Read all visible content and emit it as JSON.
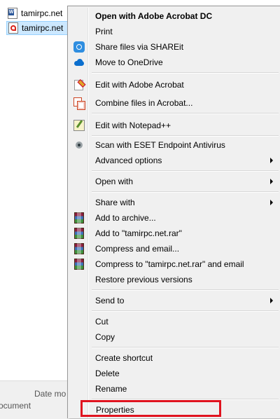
{
  "explorer": {
    "files": [
      {
        "name": "tamirpc.net",
        "icon": "word-doc-icon"
      },
      {
        "name": "tamirpc.net",
        "icon": "pdf-doc-icon"
      }
    ],
    "details": {
      "date_label": "Date mo",
      "type_label": "ocument"
    }
  },
  "menu": {
    "items": [
      {
        "label": "Open with Adobe Acrobat DC",
        "bold": true
      },
      {
        "label": "Print"
      },
      {
        "label": "Share files via SHAREit",
        "icon": "shareit-icon"
      },
      {
        "label": "Move to OneDrive",
        "icon": "onedrive-icon"
      },
      {
        "label": "Edit with Adobe Acrobat",
        "icon": "acrobat-edit-icon"
      },
      {
        "label": "Combine files in Acrobat...",
        "icon": "acrobat-combine-icon"
      },
      {
        "label": "Edit with Notepad++",
        "icon": "notepad-plus-plus-icon"
      },
      {
        "label": "Scan with ESET Endpoint Antivirus",
        "icon": "eset-icon"
      },
      {
        "label": "Advanced options",
        "submenu": true
      },
      {
        "label": "Open with",
        "submenu": true
      },
      {
        "label": "Share with",
        "submenu": true
      },
      {
        "label": "Add to archive...",
        "icon": "winrar-icon"
      },
      {
        "label": "Add to \"tamirpc.net.rar\"",
        "icon": "winrar-icon"
      },
      {
        "label": "Compress and email...",
        "icon": "winrar-icon"
      },
      {
        "label": "Compress to \"tamirpc.net.rar\" and email",
        "icon": "winrar-icon"
      },
      {
        "label": "Restore previous versions"
      },
      {
        "label": "Send to",
        "submenu": true
      },
      {
        "label": "Cut"
      },
      {
        "label": "Copy"
      },
      {
        "label": "Create shortcut"
      },
      {
        "label": "Delete"
      },
      {
        "label": "Rename"
      },
      {
        "label": "Properties"
      }
    ],
    "highlight_color": "#e0131f"
  }
}
